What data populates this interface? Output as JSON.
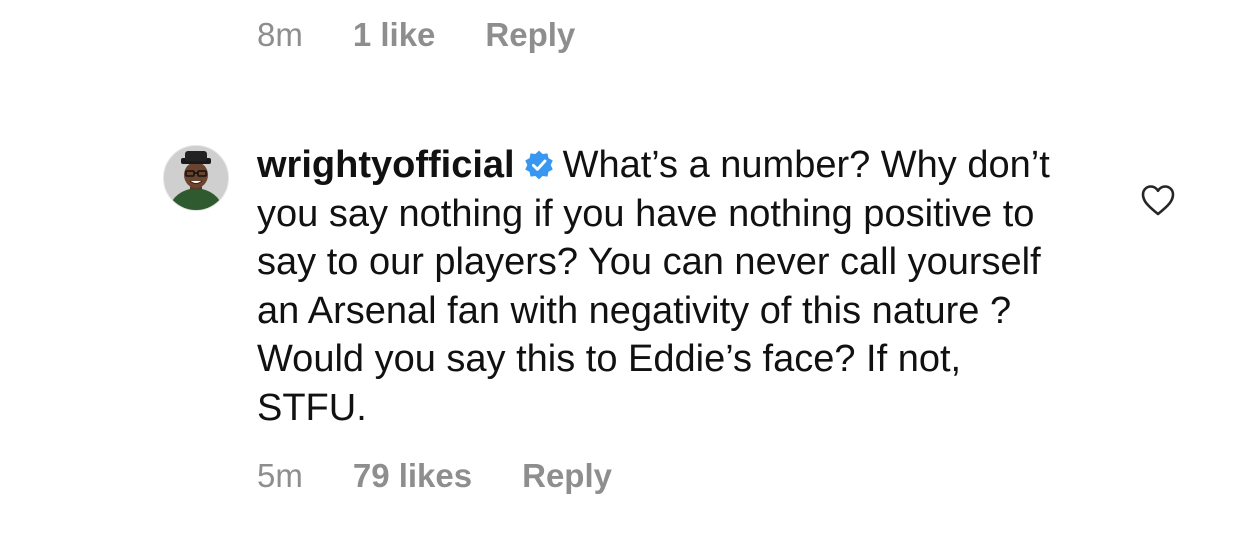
{
  "previous_comment": {
    "time": "8m",
    "likes": "1 like",
    "reply_label": "Reply"
  },
  "comment": {
    "username": "wrightyofficial",
    "verified_icon": "verified-badge-icon",
    "text": "What’s a number? Why don’t you say nothing if you have nothing positive to say to our players? You can never call yourself an Arsenal fan with negativity of this nature ? Would you say this to Eddie’s face? If not, STFU.",
    "time": "5m",
    "likes": "79 likes",
    "reply_label": "Reply",
    "like_icon": "heart-outline-icon"
  },
  "colors": {
    "meta_text": "#8e8e8e",
    "body_text": "#111111",
    "verified_blue": "#3897f0"
  }
}
